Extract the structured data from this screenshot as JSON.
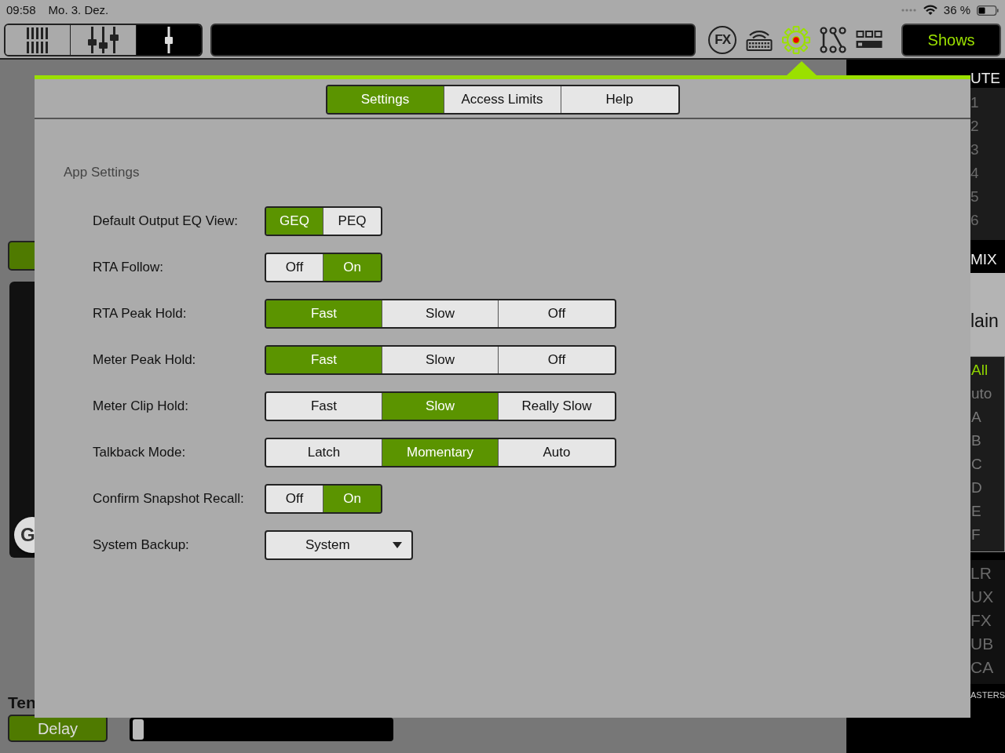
{
  "status_bar": {
    "time": "09:58",
    "date": "Mo. 3. Dez.",
    "battery": "36 %"
  },
  "toolbar": {
    "view_tabs": [
      {
        "kind": "meters",
        "selected": false
      },
      {
        "kind": "faders",
        "selected": false
      },
      {
        "kind": "single-fader",
        "selected": true
      }
    ],
    "tools": [
      {
        "kind": "fx",
        "label": "FX",
        "selected": false
      },
      {
        "kind": "keyboard",
        "selected": false
      },
      {
        "kind": "settings",
        "selected": true
      },
      {
        "kind": "routing",
        "selected": false
      },
      {
        "kind": "layout",
        "selected": false
      }
    ],
    "shows_button": "Shows"
  },
  "background": {
    "left": {
      "knob_label": "G",
      "section_label": "Ten",
      "delay_button": "Delay",
      "slider": {
        "level": 0
      }
    },
    "right": {
      "mute_header": "UTE",
      "channels": [
        "1",
        "2",
        "3",
        "4",
        "5",
        "6"
      ],
      "mix_header": "MIX",
      "main_label": "lain",
      "groups": [
        {
          "label": "All",
          "selected": true
        },
        {
          "label": "uto",
          "selected": false
        },
        {
          "label": "A",
          "selected": false
        },
        {
          "label": "B",
          "selected": false
        },
        {
          "label": "C",
          "selected": false
        },
        {
          "label": "D",
          "selected": false
        },
        {
          "label": "E",
          "selected": false
        },
        {
          "label": "F",
          "selected": false
        }
      ],
      "masters": [
        "LR",
        "UX",
        "FX",
        "UB",
        "CA"
      ],
      "masters_label": "ASTERS"
    }
  },
  "popover": {
    "tabs": [
      {
        "label": "Settings",
        "selected": true
      },
      {
        "label": "Access Limits",
        "selected": false
      },
      {
        "label": "Help",
        "selected": false
      }
    ],
    "section_title": "App Settings",
    "settings": [
      {
        "label": "Default Output EQ View:",
        "kind": "segmented",
        "options": [
          {
            "label": "GEQ",
            "selected": true
          },
          {
            "label": "PEQ",
            "selected": false
          }
        ]
      },
      {
        "label": "RTA Follow:",
        "kind": "segmented",
        "options": [
          {
            "label": "Off",
            "selected": false
          },
          {
            "label": "On",
            "selected": true
          }
        ]
      },
      {
        "label": "RTA Peak Hold:",
        "kind": "segmented",
        "options": [
          {
            "label": "Fast",
            "selected": true
          },
          {
            "label": "Slow",
            "selected": false
          },
          {
            "label": "Off",
            "selected": false
          }
        ]
      },
      {
        "label": "Meter Peak Hold:",
        "kind": "segmented",
        "options": [
          {
            "label": "Fast",
            "selected": true
          },
          {
            "label": "Slow",
            "selected": false
          },
          {
            "label": "Off",
            "selected": false
          }
        ]
      },
      {
        "label": "Meter Clip Hold:",
        "kind": "segmented",
        "options": [
          {
            "label": "Fast",
            "selected": false
          },
          {
            "label": "Slow",
            "selected": true
          },
          {
            "label": "Really Slow",
            "selected": false
          }
        ]
      },
      {
        "label": "Talkback Mode:",
        "kind": "segmented",
        "options": [
          {
            "label": "Latch",
            "selected": false
          },
          {
            "label": "Momentary",
            "selected": true
          },
          {
            "label": "Auto",
            "selected": false
          }
        ]
      },
      {
        "label": "Confirm Snapshot Recall:",
        "kind": "segmented",
        "options": [
          {
            "label": "Off",
            "selected": false
          },
          {
            "label": "On",
            "selected": true
          }
        ]
      },
      {
        "label": "System Backup:",
        "kind": "dropdown",
        "value": "System"
      }
    ]
  }
}
